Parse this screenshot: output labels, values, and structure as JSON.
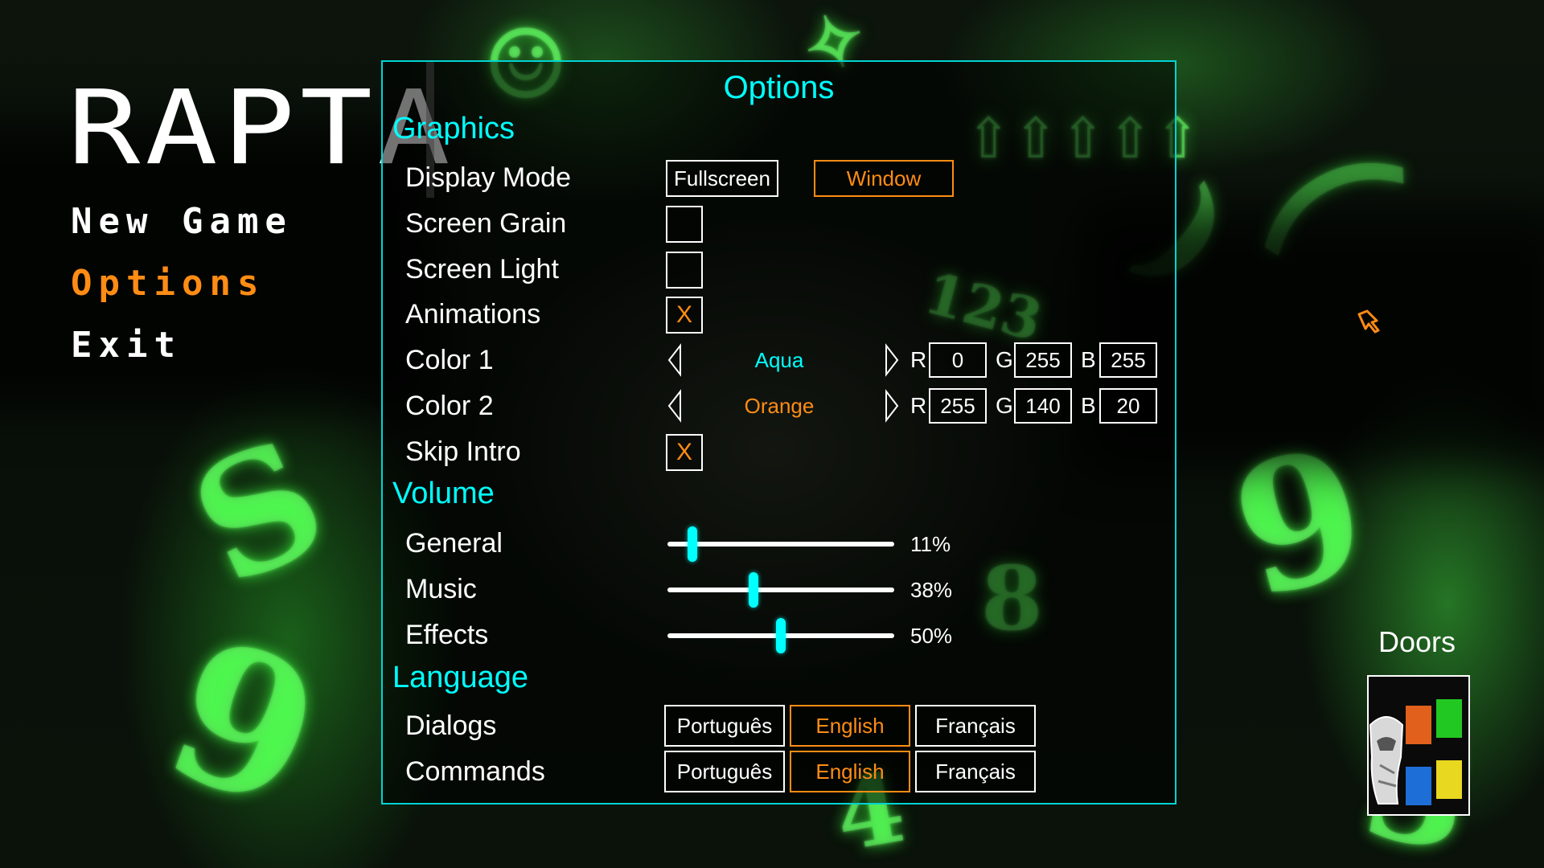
{
  "main_menu": {
    "logo_text": "RAPTA",
    "items": [
      {
        "label": "New Game",
        "active": false
      },
      {
        "label": "Options",
        "active": true
      },
      {
        "label": "Exit",
        "active": false
      }
    ]
  },
  "options": {
    "title": "Options",
    "graphics": {
      "section_title": "Graphics",
      "display_mode": {
        "label": "Display Mode",
        "choices": [
          "Fullscreen",
          "Window"
        ],
        "selected": "Window"
      },
      "screen_grain": {
        "label": "Screen Grain",
        "mark": ""
      },
      "screen_light": {
        "label": "Screen Light",
        "mark": ""
      },
      "animations": {
        "label": "Animations",
        "mark": "X"
      },
      "color1": {
        "label": "Color 1",
        "name": "Aqua",
        "r_label": "R",
        "g_label": "G",
        "b_label": "B",
        "r": "0",
        "g": "255",
        "b": "255",
        "hex": "#00ffff"
      },
      "color2": {
        "label": "Color 2",
        "name": "Orange",
        "r_label": "R",
        "g_label": "G",
        "b_label": "B",
        "r": "255",
        "g": "140",
        "b": "20",
        "hex": "#ff8c14"
      },
      "skip_intro": {
        "label": "Skip Intro",
        "mark": "X"
      }
    },
    "volume": {
      "section_title": "Volume",
      "general": {
        "label": "General",
        "value_text": "11%",
        "value": 11
      },
      "music": {
        "label": "Music",
        "value_text": "38%",
        "value": 38
      },
      "effects": {
        "label": "Effects",
        "value_text": "50%",
        "value": 50
      }
    },
    "language": {
      "section_title": "Language",
      "dialogs": {
        "label": "Dialogs",
        "choices": [
          "Português",
          "English",
          "Français"
        ],
        "selected": "English"
      },
      "commands": {
        "label": "Commands",
        "choices": [
          "Português",
          "English",
          "Français"
        ],
        "selected": "English"
      }
    }
  },
  "doors": {
    "label": "Doors",
    "tile_colors": [
      "#e0601c",
      "#22c822",
      "#1e6ed8",
      "#e8d820"
    ]
  },
  "colors": {
    "accent_primary": "#00ffff",
    "accent_secondary": "#ff8c14",
    "text": "#ffffff"
  }
}
